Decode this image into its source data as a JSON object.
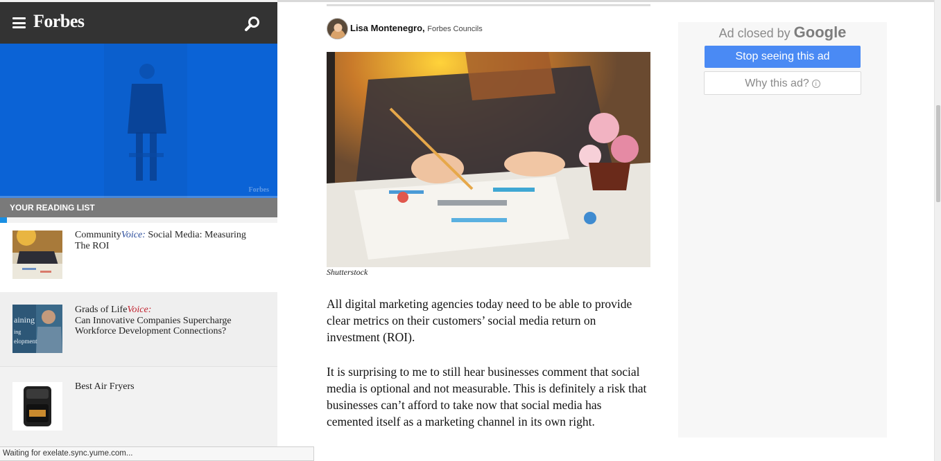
{
  "header": {
    "logo": "Forbes",
    "menu_icon": "hamburger-menu-icon",
    "search_icon": "search-icon"
  },
  "video": {
    "watermark": "Forbes"
  },
  "reading_list": {
    "title": "YOUR READING LIST",
    "items": [
      {
        "prefix": "Community",
        "voice": "Voice:",
        "headline": " Social Media: Measuring The ROI"
      },
      {
        "prefix": "Grads of Life",
        "voice": "Voice:",
        "headline": "Can Innovative Companies Supercharge Workforce Development Connections?"
      },
      {
        "prefix": "",
        "voice": "",
        "headline": "Best Air Fryers"
      }
    ]
  },
  "article": {
    "author_name": "Lisa Montenegro,",
    "author_org": "Forbes Councils",
    "image_caption": "Shutterstock",
    "paragraphs": [
      "All digital marketing agencies today need to be able to provide clear metrics on their customers’ social media return on investment (ROI).",
      "It is surprising to me to still hear businesses comment that social media is optional and not measurable. This is definitely a risk that businesses can’t afford to take now that social media has cemented itself as a marketing channel in its own right."
    ]
  },
  "ad": {
    "closed_by": "Ad closed by",
    "brand": "Google",
    "stop_label": "Stop seeing this ad",
    "why_label": "Why this ad?",
    "info_glyph": "i"
  },
  "status": {
    "text": "Waiting for exelate.sync.yume.com..."
  },
  "colors": {
    "topbar": "#333333",
    "video_bg": "#0a64d8",
    "voice_blue": "#2a4c9c",
    "voice_red": "#c0202d",
    "ad_button": "#4a8af4"
  }
}
